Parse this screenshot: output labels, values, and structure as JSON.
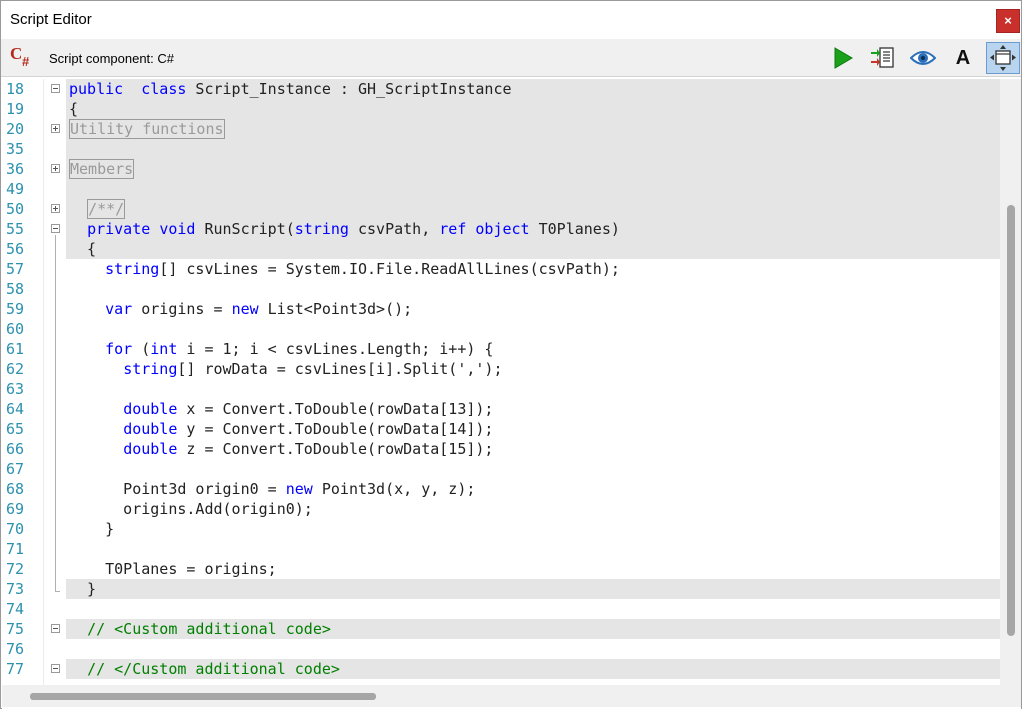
{
  "window": {
    "title": "Script Editor",
    "close_label": "×"
  },
  "toolbar": {
    "component_label": "Script component: C#",
    "cs_icon_c": "C",
    "cs_icon_hash": "#",
    "font_label": "A",
    "buttons": [
      "run-icon",
      "compile-icon",
      "eye-icon",
      "font-icon",
      "dock-icon"
    ]
  },
  "colors": {
    "keyword": "#0000ff",
    "comment": "#008000",
    "line_number": "#2b91af",
    "shaded_block": "#e5e5e5",
    "run_green": "#1aa01a",
    "close_red": "#c9302c"
  },
  "code": {
    "lines": [
      {
        "n": "18",
        "t": [
          [
            "kw",
            "public"
          ],
          [
            "",
            "  "
          ],
          [
            "kw",
            "class"
          ],
          [
            "",
            " Script_Instance : GH_ScriptInstance"
          ]
        ]
      },
      {
        "n": "19",
        "t": [
          [
            "",
            "{"
          ]
        ]
      },
      {
        "n": "20",
        "t": [
          [
            "box",
            "Utility functions"
          ]
        ]
      },
      {
        "n": "35",
        "t": []
      },
      {
        "n": "36",
        "t": [
          [
            "box",
            "Members"
          ]
        ]
      },
      {
        "n": "49",
        "t": []
      },
      {
        "n": "50",
        "t": [
          [
            "",
            "  "
          ],
          [
            "box",
            "/**/"
          ]
        ]
      },
      {
        "n": "55",
        "t": [
          [
            "",
            "  "
          ],
          [
            "kw",
            "private"
          ],
          [
            "",
            " "
          ],
          [
            "kw",
            "void"
          ],
          [
            "",
            " RunScript("
          ],
          [
            "kw",
            "string"
          ],
          [
            "",
            " csvPath, "
          ],
          [
            "kw",
            "ref"
          ],
          [
            "",
            " "
          ],
          [
            "kw",
            "object"
          ],
          [
            "",
            " T0Planes)"
          ]
        ]
      },
      {
        "n": "56",
        "t": [
          [
            "",
            "  {"
          ]
        ]
      },
      {
        "n": "57",
        "t": [
          [
            "",
            "    "
          ],
          [
            "kw",
            "string"
          ],
          [
            "",
            "[] csvLines = System.IO.File.ReadAllLines(csvPath);"
          ]
        ]
      },
      {
        "n": "58",
        "t": []
      },
      {
        "n": "59",
        "t": [
          [
            "",
            "    "
          ],
          [
            "kw",
            "var"
          ],
          [
            "",
            " origins = "
          ],
          [
            "kw",
            "new"
          ],
          [
            "",
            " List<Point3d>();"
          ]
        ]
      },
      {
        "n": "60",
        "t": []
      },
      {
        "n": "61",
        "t": [
          [
            "",
            "    "
          ],
          [
            "kw",
            "for"
          ],
          [
            "",
            " ("
          ],
          [
            "kw",
            "int"
          ],
          [
            "",
            " i = 1; i < csvLines.Length; i++) {"
          ]
        ]
      },
      {
        "n": "62",
        "t": [
          [
            "",
            "      "
          ],
          [
            "kw",
            "string"
          ],
          [
            "",
            "[] rowData = csvLines[i].Split(',');"
          ]
        ]
      },
      {
        "n": "63",
        "t": []
      },
      {
        "n": "64",
        "t": [
          [
            "",
            "      "
          ],
          [
            "kw",
            "double"
          ],
          [
            "",
            " x = Convert.ToDouble(rowData[13]);"
          ]
        ]
      },
      {
        "n": "65",
        "t": [
          [
            "",
            "      "
          ],
          [
            "kw",
            "double"
          ],
          [
            "",
            " y = Convert.ToDouble(rowData[14]);"
          ]
        ]
      },
      {
        "n": "66",
        "t": [
          [
            "",
            "      "
          ],
          [
            "kw",
            "double"
          ],
          [
            "",
            " z = Convert.ToDouble(rowData[15]);"
          ]
        ]
      },
      {
        "n": "67",
        "t": []
      },
      {
        "n": "68",
        "t": [
          [
            "",
            "      Point3d origin0 = "
          ],
          [
            "kw",
            "new"
          ],
          [
            "",
            " Point3d(x, y, z);"
          ]
        ]
      },
      {
        "n": "69",
        "t": [
          [
            "",
            "      origins.Add(origin0);"
          ]
        ]
      },
      {
        "n": "70",
        "t": [
          [
            "",
            "    }"
          ]
        ]
      },
      {
        "n": "71",
        "t": []
      },
      {
        "n": "72",
        "t": [
          [
            "",
            "    T0Planes = origins;"
          ]
        ]
      },
      {
        "n": "73",
        "t": [
          [
            "",
            "  }"
          ]
        ]
      },
      {
        "n": "74",
        "t": []
      },
      {
        "n": "75",
        "t": [
          [
            "",
            "  "
          ],
          [
            "cm",
            "// <Custom additional code>"
          ]
        ]
      },
      {
        "n": "76",
        "t": []
      },
      {
        "n": "77",
        "t": [
          [
            "",
            "  "
          ],
          [
            "cm",
            "// </Custom additional code>"
          ]
        ]
      }
    ]
  }
}
